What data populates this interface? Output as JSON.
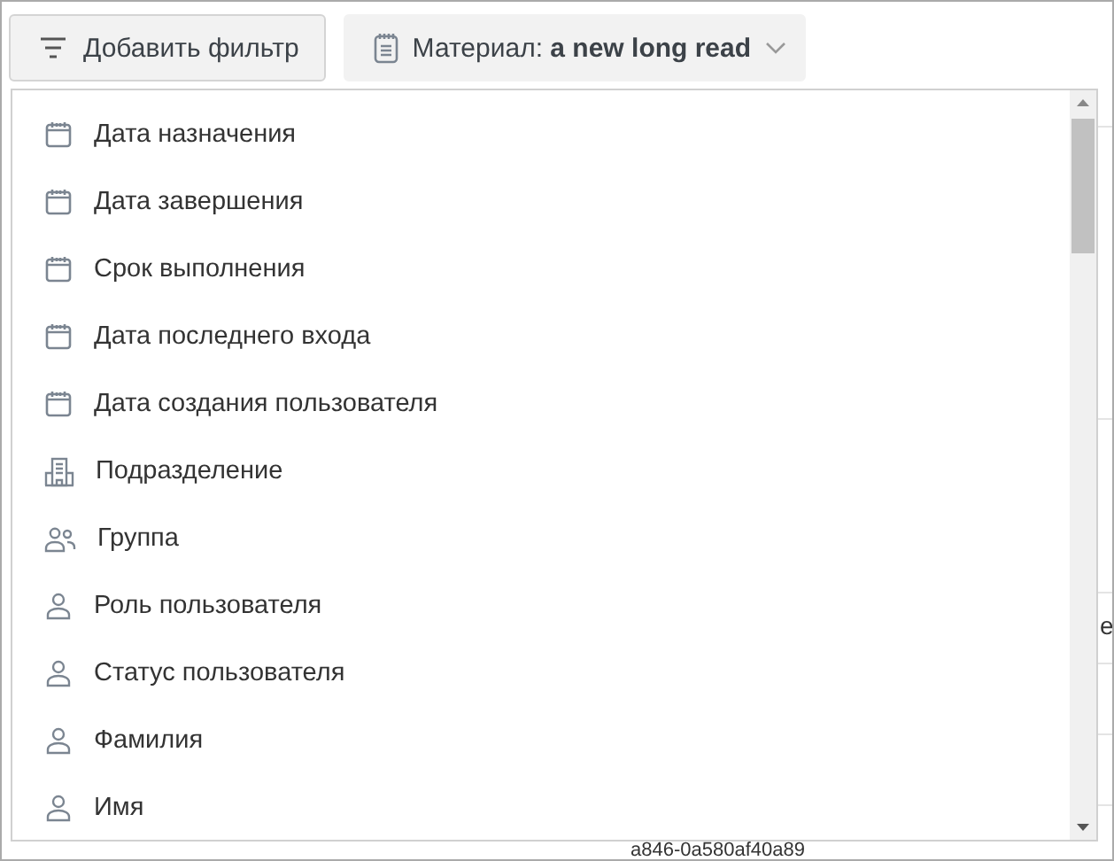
{
  "toolbar": {
    "add_filter_button": {
      "label": "Добавить фильтр"
    },
    "material_filter": {
      "label": "Материал:",
      "value": "a new long read"
    }
  },
  "dropdown": {
    "items": [
      {
        "label": "Дата назначения",
        "kind": "calendar"
      },
      {
        "label": "Дата завершения",
        "kind": "calendar"
      },
      {
        "label": "Срок выполнения",
        "kind": "calendar"
      },
      {
        "label": "Дата последнего входа",
        "kind": "calendar"
      },
      {
        "label": "Дата создания пользователя",
        "kind": "calendar"
      },
      {
        "label": "Подразделение",
        "kind": "building"
      },
      {
        "label": "Группа",
        "kind": "group"
      },
      {
        "label": "Роль пользователя",
        "kind": "person"
      },
      {
        "label": "Статус пользователя",
        "kind": "person"
      },
      {
        "label": "Фамилия",
        "kind": "person"
      },
      {
        "label": "Имя",
        "kind": "person"
      }
    ]
  },
  "background": {
    "right_cell": "e",
    "bottom_cell": "a846-0a580af40a89"
  }
}
